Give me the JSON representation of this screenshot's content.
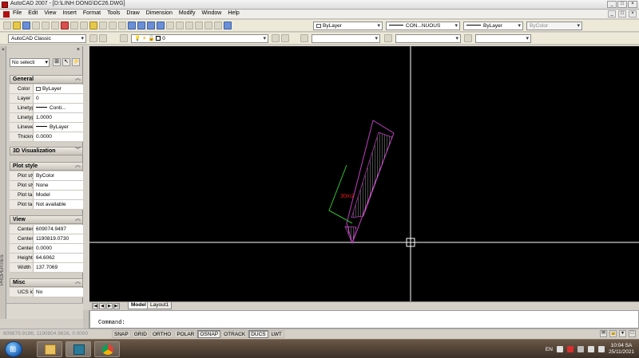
{
  "window": {
    "title": "AutoCAD 2007 - [D:\\LINH DONG\\DC26.DWG]",
    "controls": [
      "_",
      "□",
      "×"
    ]
  },
  "menu": {
    "items": [
      "File",
      "Edit",
      "View",
      "Insert",
      "Format",
      "Tools",
      "Draw",
      "Dimension",
      "Modify",
      "Window",
      "Help"
    ],
    "doc_controls": [
      "_",
      "□",
      "×"
    ]
  },
  "toolbar": {
    "layer_combo": "ByLayer",
    "linetype_combo": "CON...NUOUS",
    "lineweight_combo": "ByLayer",
    "plotstyle_combo": "ByColor",
    "workspace_combo": "AutoCAD Classic",
    "layer_state_value": "0"
  },
  "properties": {
    "header_close": "×",
    "selection": "No selecti",
    "strip_title": "PROPERTIES",
    "sections": {
      "general": "General",
      "visualization": "3D Visualization",
      "plot_style": "Plot style",
      "view": "View",
      "misc": "Misc"
    },
    "general": [
      {
        "key": "Color",
        "value": "ByLayer"
      },
      {
        "key": "Layer",
        "value": "0"
      },
      {
        "key": "Linetype",
        "value": "Conti..."
      },
      {
        "key": "Linetyp...",
        "value": "1.0000"
      },
      {
        "key": "Linewei...",
        "value": "ByLayer"
      },
      {
        "key": "Thickn...",
        "value": "0.0000"
      }
    ],
    "plot_style": [
      {
        "key": "Plot style",
        "value": "ByColor"
      },
      {
        "key": "Plot sty...",
        "value": "None"
      },
      {
        "key": "Plot ta...",
        "value": "Model"
      },
      {
        "key": "Plot ta...",
        "value": "Not available"
      }
    ],
    "view": [
      {
        "key": "Center X",
        "value": "609074.9497"
      },
      {
        "key": "Center Y",
        "value": "1190819.0730"
      },
      {
        "key": "Center Z",
        "value": "0.0000"
      },
      {
        "key": "Height",
        "value": "64.6062"
      },
      {
        "key": "Width",
        "value": "137.7069"
      }
    ],
    "misc": [
      {
        "key": "UCS ic...",
        "value": "No"
      }
    ]
  },
  "drawing": {
    "area_label": "30m2",
    "colors": {
      "background": "#000000",
      "polyline": "#c040c0",
      "boundary": "#30c030",
      "hatch": "#ffffff",
      "label": "#e02020",
      "crosshair": "#ffffff"
    }
  },
  "tabs": {
    "nav": [
      "|◀",
      "◀",
      "▶",
      "▶|"
    ],
    "model": "Model",
    "layout1": "Layout1"
  },
  "command": {
    "prompt": "Command:"
  },
  "status": {
    "coords": "609879.9186, 1190804.9626, 0.0000",
    "modes": [
      {
        "label": "SNAP",
        "on": false
      },
      {
        "label": "GRID",
        "on": false
      },
      {
        "label": "ORTHO",
        "on": false
      },
      {
        "label": "POLAR",
        "on": false
      },
      {
        "label": "OSNAP",
        "on": true
      },
      {
        "label": "OTRACK",
        "on": false
      },
      {
        "label": "DUCS",
        "on": true
      },
      {
        "label": "LWT",
        "on": false
      }
    ]
  },
  "taskbar": {
    "lang": "EN",
    "time": "10:04 SA",
    "date": "25/11/2021"
  }
}
